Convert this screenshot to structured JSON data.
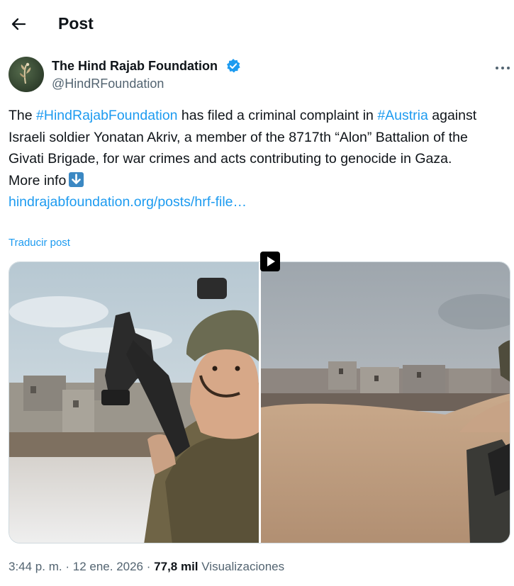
{
  "header": {
    "title": "Post"
  },
  "author": {
    "display_name": "The Hind Rajab Foundation",
    "handle": "@HindRFoundation"
  },
  "tweet": {
    "part1": "The ",
    "hashtag1": "#HindRajabFoundation",
    "part2": " has filed a criminal complaint in ",
    "hashtag2": "#Austria",
    "part3": " against Israeli soldier Yonatan Akriv, a member of the 8717th “Alon” Battalion of the Givati Brigade, for war crimes and acts contributing to genocide in Gaza.",
    "more_info": "More info",
    "more_info_icon": "down-arrow-emoji",
    "link": "hindrajabfoundation.org/posts/hrf-file…"
  },
  "translate_label": "Traducir post",
  "meta": {
    "time": "3:44 p. m.",
    "separator": "·",
    "date": "12 ene. 2026",
    "views_count": "77,8 mil",
    "views_label": "Visualizaciones"
  },
  "colors": {
    "link": "#1d9bf0",
    "verified": "#1d9bf0",
    "secondary_text": "#536471"
  }
}
